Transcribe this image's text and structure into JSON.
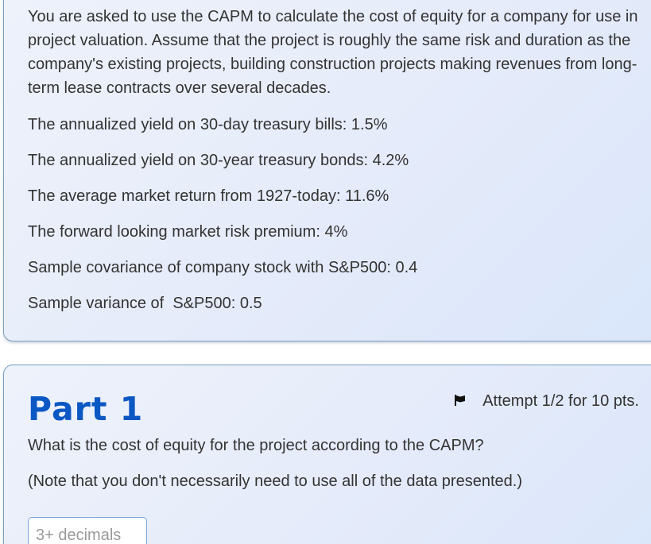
{
  "problem": {
    "intro": "You are asked to use the CAPM to calculate the cost of equity for a company for use in project valuation. Assume that the project is roughly the same risk and duration as the company's existing projects, building construction projects making revenues from long-term lease contracts over several decades.",
    "facts": [
      "The annualized yield on 30-day treasury bills: 1.5%",
      "The annualized yield on 30-year treasury bonds: 4.2%",
      "The average market return from 1927-today: 11.6%",
      "The forward looking market risk premium: 4%",
      "Sample covariance of company stock with S&P500: 0.4",
      "Sample variance of  S&P500: 0.5"
    ]
  },
  "part": {
    "title": "Part 1",
    "attempt_label": "Attempt 1/2 for 10 pts.",
    "question": "What is the cost of equity for the project according to the CAPM?",
    "note": "(Note that you don't necessarily need to use all of the data presented.)",
    "answer": {
      "value": "",
      "placeholder": "3+ decimals"
    }
  },
  "icons": {
    "flag": "flag-icon"
  },
  "colors": {
    "part_title": "#0b57c4",
    "card_border": "#7b9ec0",
    "card_bg": "#e5ebfa",
    "input_border": "#7aa7d9"
  }
}
